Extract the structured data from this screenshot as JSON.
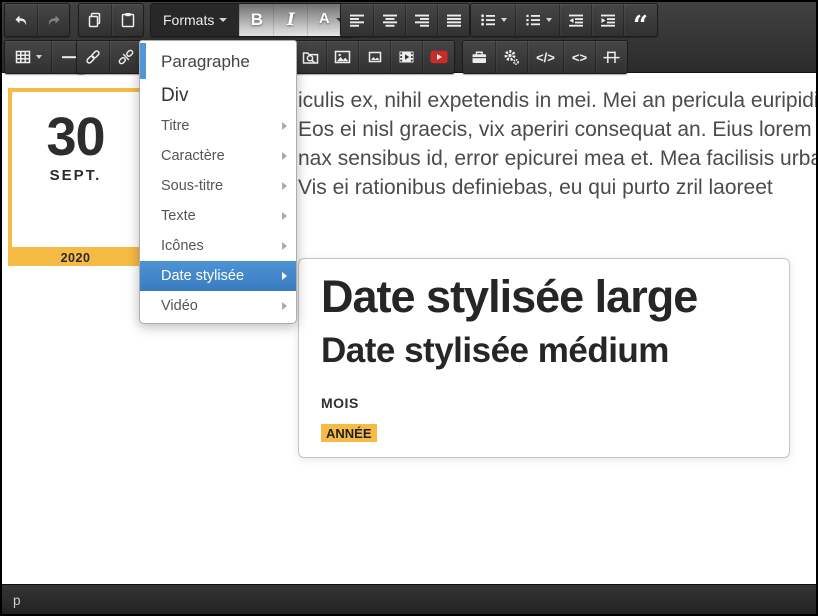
{
  "toolbar": {
    "formats_label": "Formats",
    "bold_label": "B",
    "italic_label": "I",
    "forecolor_label": "A",
    "source_code_label": "</>",
    "inline_code_label": "<>",
    "blockquote_glyph": "“"
  },
  "formats_menu": {
    "items": [
      {
        "label": "Paragraphe"
      },
      {
        "label": "Div"
      },
      {
        "label": "Titre"
      },
      {
        "label": "Caractère"
      },
      {
        "label": "Sous-titre"
      },
      {
        "label": "Texte"
      },
      {
        "label": "Icônes"
      },
      {
        "label": "Date stylisée"
      },
      {
        "label": "Vidéo"
      }
    ]
  },
  "date_styles_submenu": {
    "large_label": "Date stylisée large",
    "medium_label": "Date stylisée médium",
    "month_label": "MOIS",
    "year_label": "ANNÉE"
  },
  "editor_content": {
    "date_widget": {
      "day": "30",
      "month": "SEPT.",
      "year": "2020"
    },
    "paragraph_lines": [
      "iculis ex, nihil expetendis in mei. Mei an pericula euripidis, hinc",
      "Eos ei nisl graecis, vix aperiri consequat an. Eius lorem tincidunt",
      "nax sensibus id, error epicurei mea et. Mea facilisis urbanitas",
      "Vis ei rationibus definiebas, eu qui purto zril laoreet"
    ]
  },
  "statusbar": {
    "element_path": "p"
  },
  "colors": {
    "accent_yellow": "#F6BB45",
    "menu_highlight": "#3E82C8",
    "accent_bar_blue": "#4F97D7",
    "youtube_red": "#CC2B27"
  }
}
